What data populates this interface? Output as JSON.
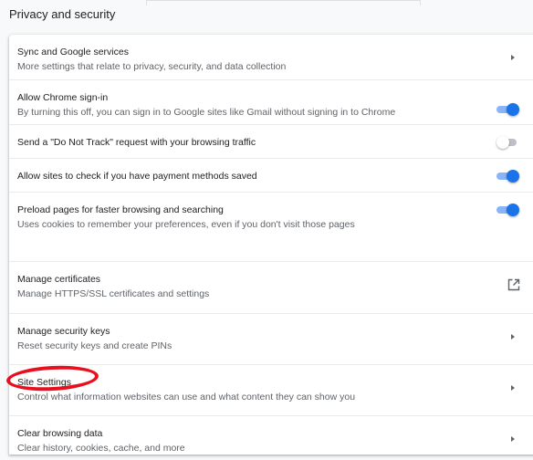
{
  "section_title": "Privacy and security",
  "rows": [
    {
      "title": "Sync and Google services",
      "sub": "More settings that relate to privacy, security, and data collection",
      "control": "arrow"
    },
    {
      "title": "Allow Chrome sign-in",
      "sub": "By turning this off, you can sign in to Google sites like Gmail without signing in to Chrome",
      "control": "toggle",
      "state": "on"
    },
    {
      "title": "Send a \"Do Not Track\" request with your browsing traffic",
      "sub": "",
      "control": "toggle",
      "state": "off"
    },
    {
      "title": "Allow sites to check if you have payment methods saved",
      "sub": "",
      "control": "toggle",
      "state": "on"
    },
    {
      "title": "Preload pages for faster browsing and searching",
      "sub": "Uses cookies to remember your preferences, even if you don't visit those pages",
      "control": "toggle",
      "state": "on"
    },
    {
      "title": "Manage certificates",
      "sub": "Manage HTTPS/SSL certificates and settings",
      "control": "external-link-icon"
    },
    {
      "title": "Manage security keys",
      "sub": "Reset security keys and create PINs",
      "control": "arrow"
    },
    {
      "title": "Site Settings",
      "sub": "Control what information websites can use and what content they can show you",
      "control": "arrow",
      "highlighted": true
    },
    {
      "title": "Clear browsing data",
      "sub": "Clear history, cookies, cache, and more",
      "control": "arrow"
    }
  ],
  "colors": {
    "accent": "#1a73e8",
    "accent_track": "#8ab4f8",
    "highlight_circle": "#e8101e"
  }
}
